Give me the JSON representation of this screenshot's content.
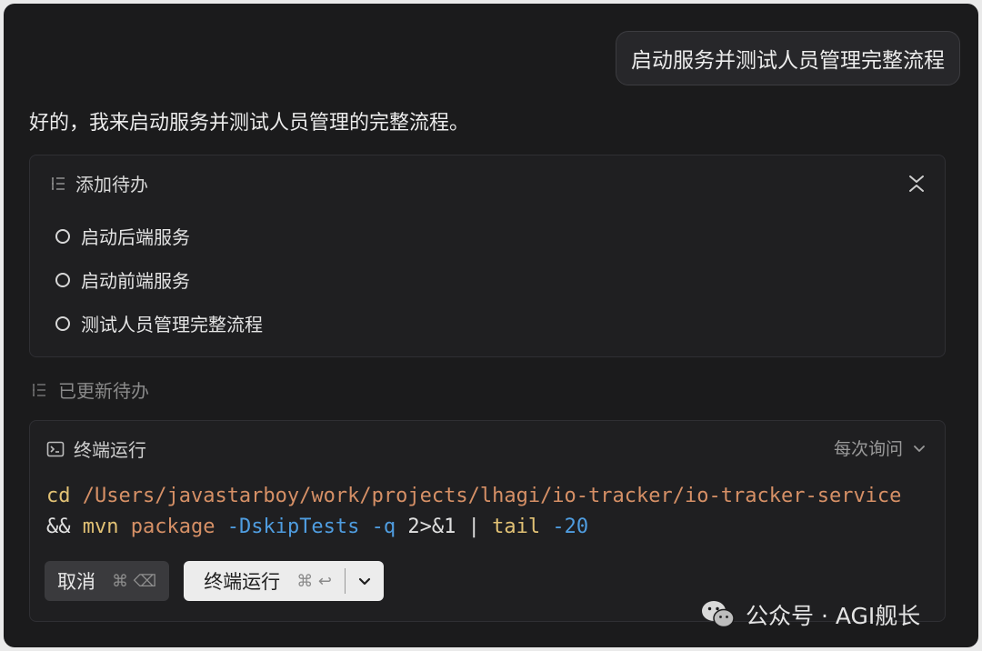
{
  "user_message": "启动服务并测试人员管理完整流程",
  "assistant_reply": "好的，我来启动服务并测试人员管理的完整流程。",
  "todo_card": {
    "title": "添加待办",
    "items": [
      {
        "label": "启动后端服务"
      },
      {
        "label": "启动前端服务"
      },
      {
        "label": "测试人员管理完整流程"
      }
    ]
  },
  "updated_label": "已更新待办",
  "terminal_card": {
    "title": "终端运行",
    "ask_mode": "每次询问",
    "command": {
      "cmd": "cd",
      "path": "/Users/javastarboy/work/projects/lhagi/io-tracker/io-tracker-service",
      "op": "&&",
      "tool": "mvn",
      "arg": "package",
      "flag1": "-DskipTests",
      "flag2": "-q",
      "redirect": "2>&1",
      "pipe": "|",
      "tail": "tail",
      "flag3": "-20"
    },
    "cancel_label": "取消",
    "cancel_shortcut": "⌘ ⌫",
    "run_label": "终端运行",
    "run_shortcut": "⌘ ↩"
  },
  "watermark": "公众号 · AGI舰长"
}
